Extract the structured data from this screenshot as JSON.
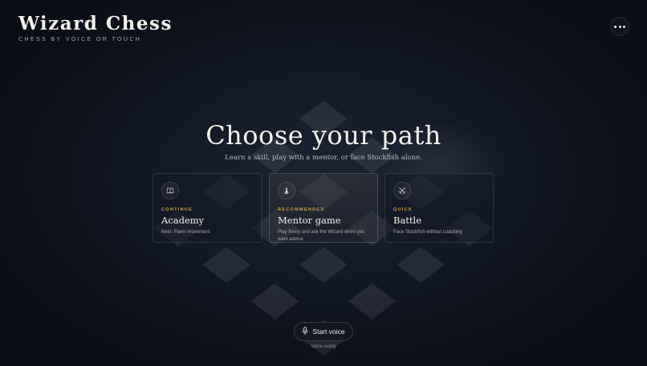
{
  "brand": {
    "title": "Wizard Chess",
    "tagline": "CHESS BY VOICE OR TOUCH"
  },
  "menu": {
    "icon": "more-horizontal-icon"
  },
  "hero": {
    "heading": "Choose your path",
    "subheading": "Learn a skill, play with a mentor, or face Stockfish alone."
  },
  "cards": [
    {
      "icon": "book-icon",
      "eyebrow": "CONTINUE",
      "title": "Academy",
      "description": "Next: Pawn movement"
    },
    {
      "icon": "pawn-icon",
      "eyebrow": "RECOMMENDED",
      "title": "Mentor game",
      "description": "Play freely and ask the Wizard when you want advice"
    },
    {
      "icon": "crossed-swords-icon",
      "eyebrow": "QUICK",
      "title": "Battle",
      "description": "Face Stockfish without coaching"
    }
  ],
  "voice": {
    "button_label": "Start voice",
    "status": "Voice ready",
    "icon": "microphone-icon"
  },
  "colors": {
    "accent": "#c9a24a",
    "background": "#0c1019",
    "text": "#f3f1ec"
  }
}
